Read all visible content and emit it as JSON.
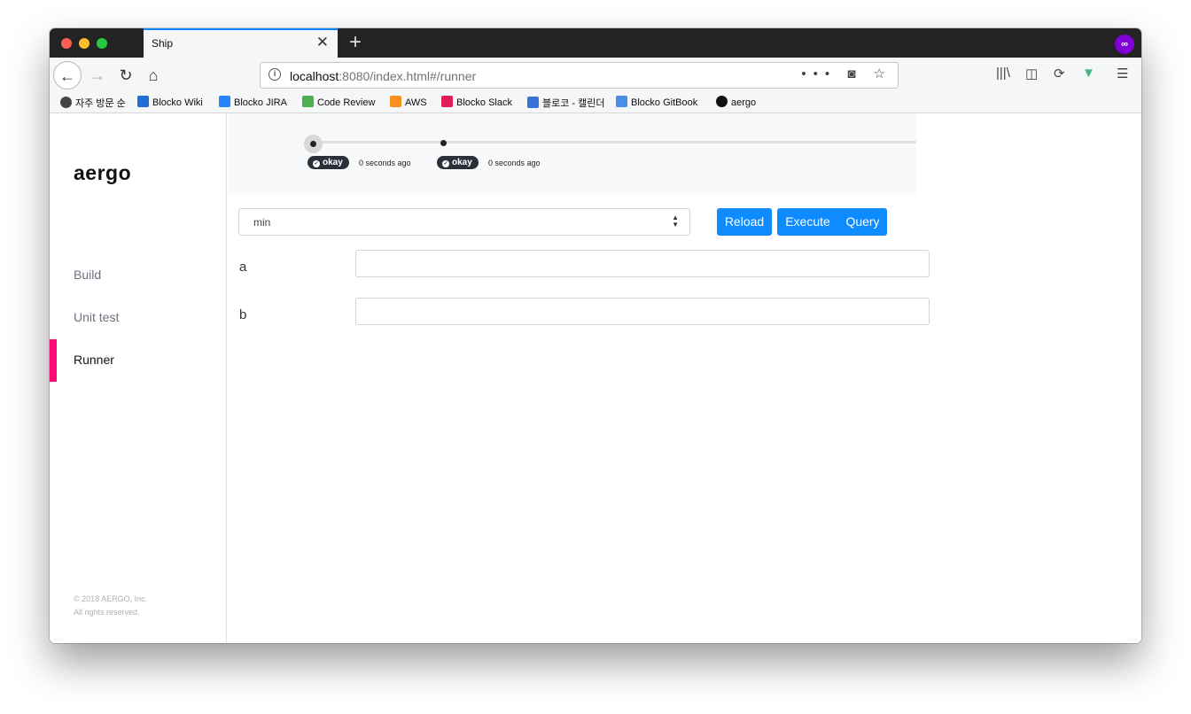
{
  "browser": {
    "tab_title": "Ship",
    "tab_close": "✕",
    "new_tab": "+",
    "url_host": "localhost",
    "url_rest": ":8080/index.html#/runner",
    "url_actions": "••• ◙ ☆",
    "bookmarks": [
      {
        "label": "자주 방문 순",
        "color": "#444444"
      },
      {
        "label": "Blocko Wiki",
        "color": "#1f6fd6"
      },
      {
        "label": "Blocko JIRA",
        "color": "#2684ff"
      },
      {
        "label": "Code Review",
        "color": "#4caf50"
      },
      {
        "label": "AWS",
        "color": "#f7901e"
      },
      {
        "label": "Blocko Slack",
        "color": "#e01e5a"
      },
      {
        "label": "블로코 - 캘린더",
        "color": "#3a73d8"
      },
      {
        "label": "Blocko GitBook",
        "color": "#4a8fe7"
      },
      {
        "label": "aergo",
        "color": "#111111"
      }
    ]
  },
  "sidebar": {
    "logo": "aergo",
    "items": [
      {
        "label": "Build",
        "active": false
      },
      {
        "label": "Unit test",
        "active": false
      },
      {
        "label": "Runner",
        "active": true
      }
    ],
    "copyright_line1": "© 2018 AERGO, Inc.",
    "copyright_line2": "All rights reserved."
  },
  "timeline": {
    "events": [
      {
        "status": "okay",
        "time": "0 seconds ago"
      },
      {
        "status": "okay",
        "time": "0 seconds ago"
      }
    ]
  },
  "runner": {
    "function_select": "min",
    "buttons": {
      "reload": "Reload",
      "execute": "Execute",
      "query": "Query"
    },
    "args": [
      {
        "name": "a",
        "value": ""
      },
      {
        "name": "b",
        "value": ""
      }
    ]
  },
  "colors": {
    "accent": "#0d8bff",
    "active_marker": "#ff0a78",
    "badge_bg": "#2a2f3a"
  }
}
